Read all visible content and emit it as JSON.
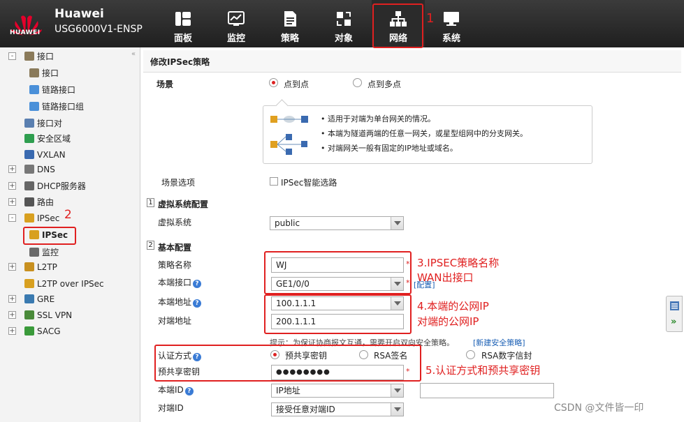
{
  "header": {
    "brand": "Huawei",
    "model": "USG6000V1-ENSP",
    "logo_text": "HUAWEI",
    "nav": [
      {
        "label": "面板",
        "icon": "dashboard-icon"
      },
      {
        "label": "监控",
        "icon": "monitor-icon"
      },
      {
        "label": "策略",
        "icon": "policy-icon"
      },
      {
        "label": "对象",
        "icon": "object-icon"
      },
      {
        "label": "网络",
        "icon": "network-icon",
        "active": true
      },
      {
        "label": "系统",
        "icon": "system-icon"
      }
    ]
  },
  "annotations": {
    "n1": "1",
    "n2": "2",
    "a3": "3.IPSEC策略名称",
    "a3b": "WAN出接口",
    "a4": "4.本端的公网IP",
    "a4b": "对端的公网IP",
    "a5": "5.认证方式和预共享密钥"
  },
  "sidebar": {
    "items": [
      {
        "label": "接口",
        "pm": "-"
      },
      {
        "label": "接口"
      },
      {
        "label": "链路接口"
      },
      {
        "label": "链路接口组"
      },
      {
        "label": "接口对"
      },
      {
        "label": "安全区域"
      },
      {
        "label": "VXLAN"
      },
      {
        "label": "DNS",
        "pm": "+"
      },
      {
        "label": "DHCP服务器",
        "pm": "+"
      },
      {
        "label": "路由",
        "pm": "+"
      },
      {
        "label": "IPSec",
        "pm": "-"
      },
      {
        "label": "IPSec"
      },
      {
        "label": "监控"
      },
      {
        "label": "L2TP",
        "pm": "+"
      },
      {
        "label": "L2TP over IPSec"
      },
      {
        "label": "GRE",
        "pm": "+"
      },
      {
        "label": "SSL VPN",
        "pm": "+"
      },
      {
        "label": "SACG",
        "pm": "+"
      }
    ]
  },
  "main": {
    "title": "修改IPSec策略",
    "scene_label": "场景",
    "scene_opt1": "点到点",
    "scene_opt2": "点到多点",
    "info_lines": [
      "适用于对端为单台网关的情况。",
      "本端为隧道两端的任意一网关，或星型组网中的分支网关。",
      "对端网关一般有固定的IP地址或域名。"
    ],
    "scene_options_label": "场景选项",
    "smart_route_label": "IPSec智能选路",
    "sec1_num": "1",
    "sec1_title": "虚拟系统配置",
    "vsys_label": "虚拟系统",
    "vsys_value": "public",
    "sec2_num": "2",
    "sec2_title": "基本配置",
    "policy_name_label": "策略名称",
    "policy_name_value": "WJ",
    "local_if_label": "本端接口",
    "local_if_value": "GE1/0/0",
    "config_link": "[配置]",
    "local_addr_label": "本端地址",
    "local_addr_value": "100.1.1.1",
    "peer_addr_label": "对端地址",
    "peer_addr_value": "200.1.1.1",
    "hint": "提示：为保证协商报文互通，需要开启双向安全策略。",
    "new_policy_link": "[新建安全策略]",
    "auth_label": "认证方式",
    "auth_opt1": "预共享密钥",
    "auth_opt2": "RSA签名",
    "auth_opt3": "RSA数字信封",
    "psk_label": "预共享密钥",
    "psk_value": "●●●●●●●●",
    "local_id_label": "本端ID",
    "local_id_value": "IP地址",
    "peer_id_label": "对端ID",
    "peer_id_value": "接受任意对端ID",
    "star": "*",
    "help": "?"
  },
  "watermark": "CSDN @文件皆一印"
}
